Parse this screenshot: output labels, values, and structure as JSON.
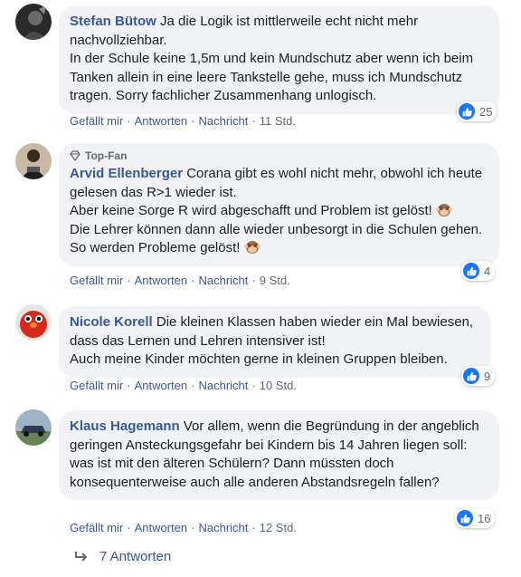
{
  "comments": [
    {
      "author": "Stefan Bütow",
      "text": "Ja die Logik ist mittlerweile echt nicht mehr nachvollziehbar.\nIn der Schule keine 1,5m und kein Mundschutz aber wenn ich beim Tanken allein in eine leere Tankstelle gehe, muss ich Mundschutz tragen. Sorry fachlicher Zusammenhang unlogisch.",
      "like_label": "Gefällt mir",
      "reply_label": "Antworten",
      "message_label": "Nachricht",
      "time": "11 Std.",
      "reactions": "25"
    },
    {
      "badge": "Top-Fan",
      "author": "Arvid Ellenberger",
      "text_1": "Corana gibt es wohl nicht mehr, obwohl ich heute gelesen das R>1 wieder ist.\nAber keine Sorge R wird abgeschafft und Problem ist gelöst!",
      "text_2": "\nDie Lehrer können dann alle wieder unbesorgt in die Schulen gehen. So werden Probleme gelöst!",
      "like_label": "Gefällt mir",
      "reply_label": "Antworten",
      "message_label": "Nachricht",
      "time": "9 Std.",
      "reactions": "4"
    },
    {
      "author": "Nicole Korell",
      "text": "Die kleinen Klassen haben wieder ein Mal bewiesen, dass das Lernen und Lehren intensiver ist!\nAuch meine Kinder möchten gerne in kleinen Gruppen bleiben.",
      "like_label": "Gefällt mir",
      "reply_label": "Antworten",
      "message_label": "Nachricht",
      "time": "10 Std.",
      "reactions": "9"
    },
    {
      "author": "Klaus Hagemann",
      "text": "Vor allem, wenn die Begründung in der angeblich geringen Ansteckungsgefahr bei Kindern bis 14 Jahren liegen soll: was ist mit den älteren Schülern? Dann müssten doch konsequenterweise auch alle anderen Abstandsregeln fallen?",
      "like_label": "Gefällt mir",
      "reply_label": "Antworten",
      "message_label": "Nachricht",
      "time": "12 Std.",
      "reactions": "16"
    }
  ],
  "replies_link": "7 Antworten",
  "icons": {
    "like": "thumbs-up-icon",
    "top_fan": "diamond-icon",
    "emoji": "see-no-evil-monkey-icon",
    "reply_arrow": "reply-arrow-icon"
  },
  "colors": {
    "link": "#385898",
    "bubble": "#f0f2f5",
    "like_blue": "#1877f2",
    "meta": "#606770"
  }
}
